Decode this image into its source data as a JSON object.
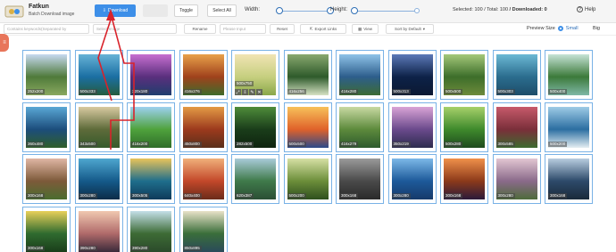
{
  "header": {
    "title": "Fatkun",
    "subtitle": "Batch Download image",
    "logo_icon": "fatkun-logo-icon"
  },
  "toolbar": {
    "download_label": "Download",
    "toggle_label": "Toggle",
    "select_all_label": "Select All",
    "width_label": "Width:",
    "height_label": "Height:",
    "width_slider_value": 0.05,
    "height_slider_value": 0.03
  },
  "stats": {
    "selected_label": "Selected:",
    "selected": "100",
    "total_label": "/ Total:",
    "total": "100",
    "downloaded_label": "/ Downloaded:",
    "downloaded": "0"
  },
  "help": {
    "label": "Help"
  },
  "filters": {
    "keyword_placeholder": "Contains keywords(Separated by",
    "select_placeholder": "Select Image",
    "rename_label": "Rename",
    "please_input_placeholder": "Please Input",
    "reset_label": "Reset",
    "export_label": "Export Links",
    "view_label": "View",
    "sort_label": "Sort by Default"
  },
  "preview": {
    "label": "Preview Size",
    "small_label": "Small",
    "big_label": "Big",
    "selected": "Small"
  },
  "accent": "#3d8fe8",
  "annotation_color": "#d9232b",
  "images": [
    {
      "dims": "252x200",
      "c1": "#4f7a3a",
      "c2": "#c7d9f0",
      "c3": "#89a85f"
    },
    {
      "dims": "500x333",
      "c1": "#1b6fa3",
      "c2": "#66b2d6",
      "c3": "#245d3f"
    },
    {
      "dims": "320x180",
      "c1": "#5a2f7d",
      "c2": "#c76fd0",
      "c3": "#1f3d6e"
    },
    {
      "dims": "416x276",
      "c1": "#a0421c",
      "c2": "#e8a14a",
      "c3": "#3e6b2a"
    },
    {
      "dims": "500x750",
      "c1": "#c6cf7f",
      "c2": "#f1e4b4",
      "c3": "#8aa84a"
    },
    {
      "dims": "416x256",
      "c1": "#2e5a2b",
      "c2": "#89a86e",
      "c3": "#d6e2c4"
    },
    {
      "dims": "416x280",
      "c1": "#2d5e8c",
      "c2": "#8fc3e8",
      "c3": "#3c6b34"
    },
    {
      "dims": "500x313",
      "c1": "#0d2248",
      "c2": "#5c79b8",
      "c3": "#0b1832"
    },
    {
      "dims": "500x500",
      "c1": "#3d6e2a",
      "c2": "#a4c87a",
      "c3": "#6d8a3b"
    },
    {
      "dims": "500x303",
      "c1": "#2b6d8e",
      "c2": "#6bb8d4",
      "c3": "#1d4d6a"
    },
    {
      "dims": "500x400",
      "c1": "#3c7a3a",
      "c2": "#c6e3d6",
      "c3": "#7fb8a6"
    },
    {
      "dims": "360x480",
      "c1": "#1c4d7c",
      "c2": "#59a7d5",
      "c3": "#2f5e2a"
    },
    {
      "dims": "343x500",
      "c1": "#5e6b3a",
      "c2": "#d8c9a0",
      "c3": "#355a2b"
    },
    {
      "dims": "416x200",
      "c1": "#4fa23c",
      "c2": "#9dd1f0",
      "c3": "#2f6d2a"
    },
    {
      "dims": "450x800",
      "c1": "#9c3a1d",
      "c2": "#e39a45",
      "c3": "#5a2f1a"
    },
    {
      "dims": "282x500",
      "c1": "#1a3d1a",
      "c2": "#4e8c3a",
      "c3": "#0f240f"
    },
    {
      "dims": "500x500",
      "c1": "#e0622a",
      "c2": "#f7c15a",
      "c3": "#2b4a8a"
    },
    {
      "dims": "416x279",
      "c1": "#5d8a3c",
      "c2": "#c8d9a2",
      "c3": "#2d5a2d"
    },
    {
      "dims": "350x219",
      "c1": "#6b4a8c",
      "c2": "#d9a3d6",
      "c3": "#2c2c4e"
    },
    {
      "dims": "500x280",
      "c1": "#3f8a2c",
      "c2": "#a6d06a",
      "c3": "#1e4a1e"
    },
    {
      "dims": "300x585",
      "c1": "#7a2f3a",
      "c2": "#c75a6b",
      "c3": "#3d6b2f"
    },
    {
      "dims": "500x200",
      "c1": "#2c6ea1",
      "c2": "#9ecbe6",
      "c3": "#e4eef2"
    },
    {
      "dims": "300x168",
      "c1": "#7d5a3a",
      "c2": "#e0b6a4",
      "c3": "#4a6d2f"
    },
    {
      "dims": "300x280",
      "c1": "#155a8a",
      "c2": "#4ea6cf",
      "c3": "#0c2c48"
    },
    {
      "dims": "300x505",
      "c1": "#1f6e8c",
      "c2": "#e8c35a",
      "c3": "#0e3a5a"
    },
    {
      "dims": "640x400",
      "c1": "#c3482a",
      "c2": "#f0b07a",
      "c3": "#6b2b1a"
    },
    {
      "dims": "620x387",
      "c1": "#3f7a4a",
      "c2": "#a9cbd9",
      "c3": "#2b4f35"
    },
    {
      "dims": "500x200",
      "c1": "#6c8e3a",
      "c2": "#d6e0a4",
      "c3": "#2e4f1e"
    },
    {
      "dims": "300x168",
      "c1": "#4a4a4a",
      "c2": "#9a9a9a",
      "c3": "#2a2a2a"
    },
    {
      "dims": "300x280",
      "c1": "#1d5a9a",
      "c2": "#7cb8e8",
      "c3": "#163a6a"
    },
    {
      "dims": "300x168",
      "c1": "#8c3a1a",
      "c2": "#f0904a",
      "c3": "#2b1a3a"
    },
    {
      "dims": "300x280",
      "c1": "#8a6a8a",
      "c2": "#e2c6d2",
      "c3": "#4e6b3a"
    },
    {
      "dims": "300x168",
      "c1": "#2d4a6a",
      "c2": "#b8cde0",
      "c3": "#1a2a3a"
    },
    {
      "dims": "300x168",
      "c1": "#2f6b2f",
      "c2": "#e8d05a",
      "c3": "#1a3d1a"
    },
    {
      "dims": "390x280",
      "c1": "#b06a6a",
      "c2": "#f0c8b0",
      "c3": "#3a2a3a"
    },
    {
      "dims": "390x280",
      "c1": "#3d6b35",
      "c2": "#c4dfe8",
      "c3": "#2b4a2b"
    },
    {
      "dims": "850x895",
      "c1": "#3a6e3a",
      "c2": "#e8e2c8",
      "c3": "#2a4a5a"
    }
  ]
}
